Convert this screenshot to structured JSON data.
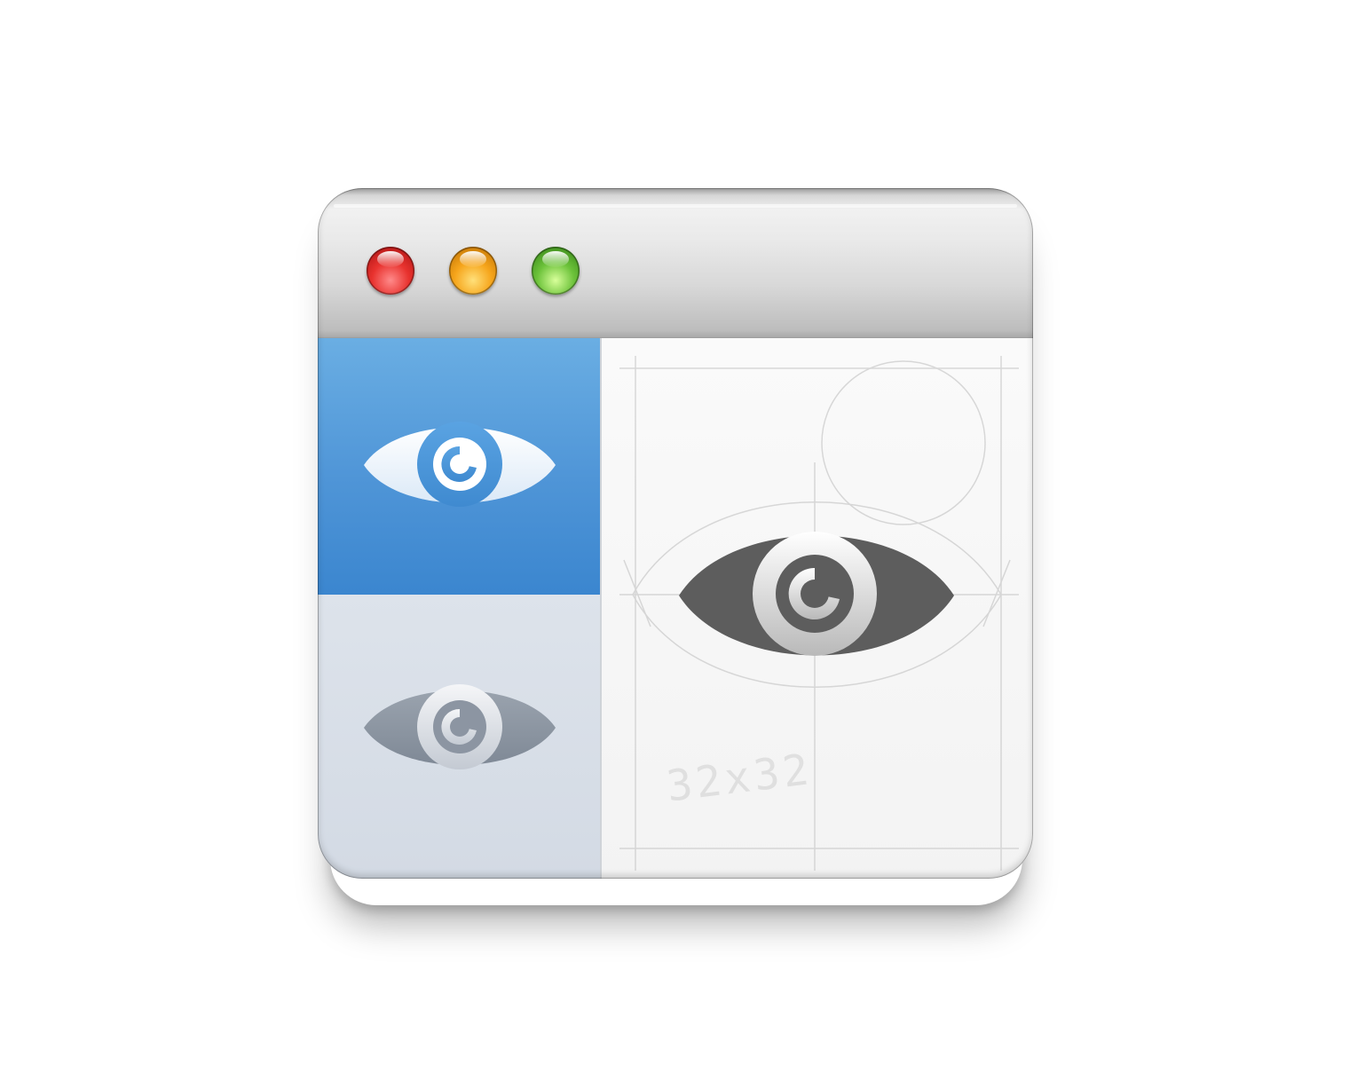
{
  "window": {
    "controls": [
      {
        "name": "close",
        "color": "#e8322e"
      },
      {
        "name": "minimize",
        "color": "#f6a51b"
      },
      {
        "name": "zoom",
        "color": "#6cc23a"
      }
    ]
  },
  "sidebar": {
    "items": [
      {
        "icon": "eye-icon",
        "state": "selected",
        "background": "#4f95d7"
      },
      {
        "icon": "eye-icon",
        "state": "unselected",
        "background": "#d8dee7"
      }
    ]
  },
  "content": {
    "icon": "eye-icon",
    "icon_color": "#5a5a5a",
    "sketch_label": "32x32"
  }
}
